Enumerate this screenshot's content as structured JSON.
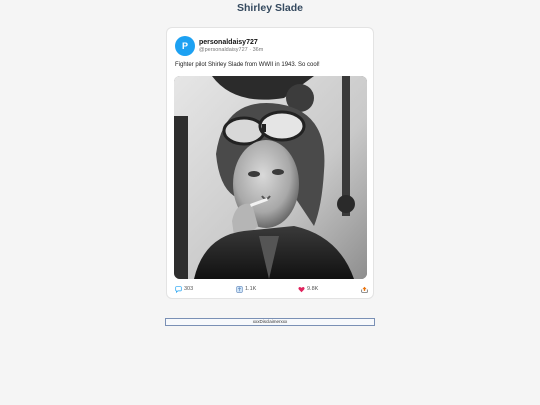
{
  "page": {
    "title": "Shirley Slade"
  },
  "post": {
    "avatar_letter": "P",
    "username": "personaldaisy727",
    "handle_time": "@personaldaisy727 · 36m",
    "text": "Fighter pilot Shirley Slade from WWII in 1943. So cool!",
    "photo_icon": "black-and-white-photo-aviator-woman",
    "actions": {
      "comments": "303",
      "retweets": "1.1K",
      "likes": "9.8K"
    }
  },
  "footer": {
    "disclaimer": "xxxDisclaimerxxx"
  },
  "colors": {
    "title": "#34495e",
    "avatar": "#1da1f2",
    "like": "#e0245e",
    "retweet": "#17bf63",
    "comment": "#1da1f2",
    "share": "#e8710a"
  }
}
